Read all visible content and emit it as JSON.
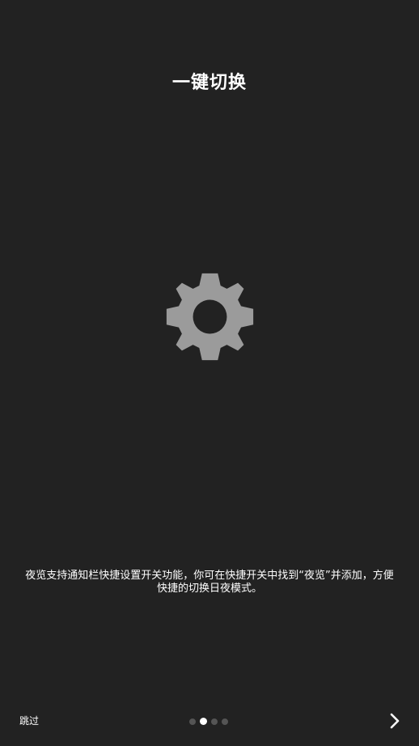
{
  "header": {
    "title": "一键切换"
  },
  "illustration": {
    "icon": "gear-icon",
    "color": "#9b9b9b"
  },
  "description": {
    "line1": "夜览支持通知栏快捷设置开关功能，你可在快捷开关中找到“夜览”并添加，方便",
    "line2": "快捷的切换日夜模式。"
  },
  "footer": {
    "skip_label": "跳过",
    "page_indicator": {
      "total": 4,
      "active_index": 1
    },
    "next_icon": "chevron-right-icon"
  },
  "colors": {
    "background": "#222222",
    "text": "#ffffff",
    "dot_inactive": "#555555",
    "dot_active": "#ffffff"
  }
}
